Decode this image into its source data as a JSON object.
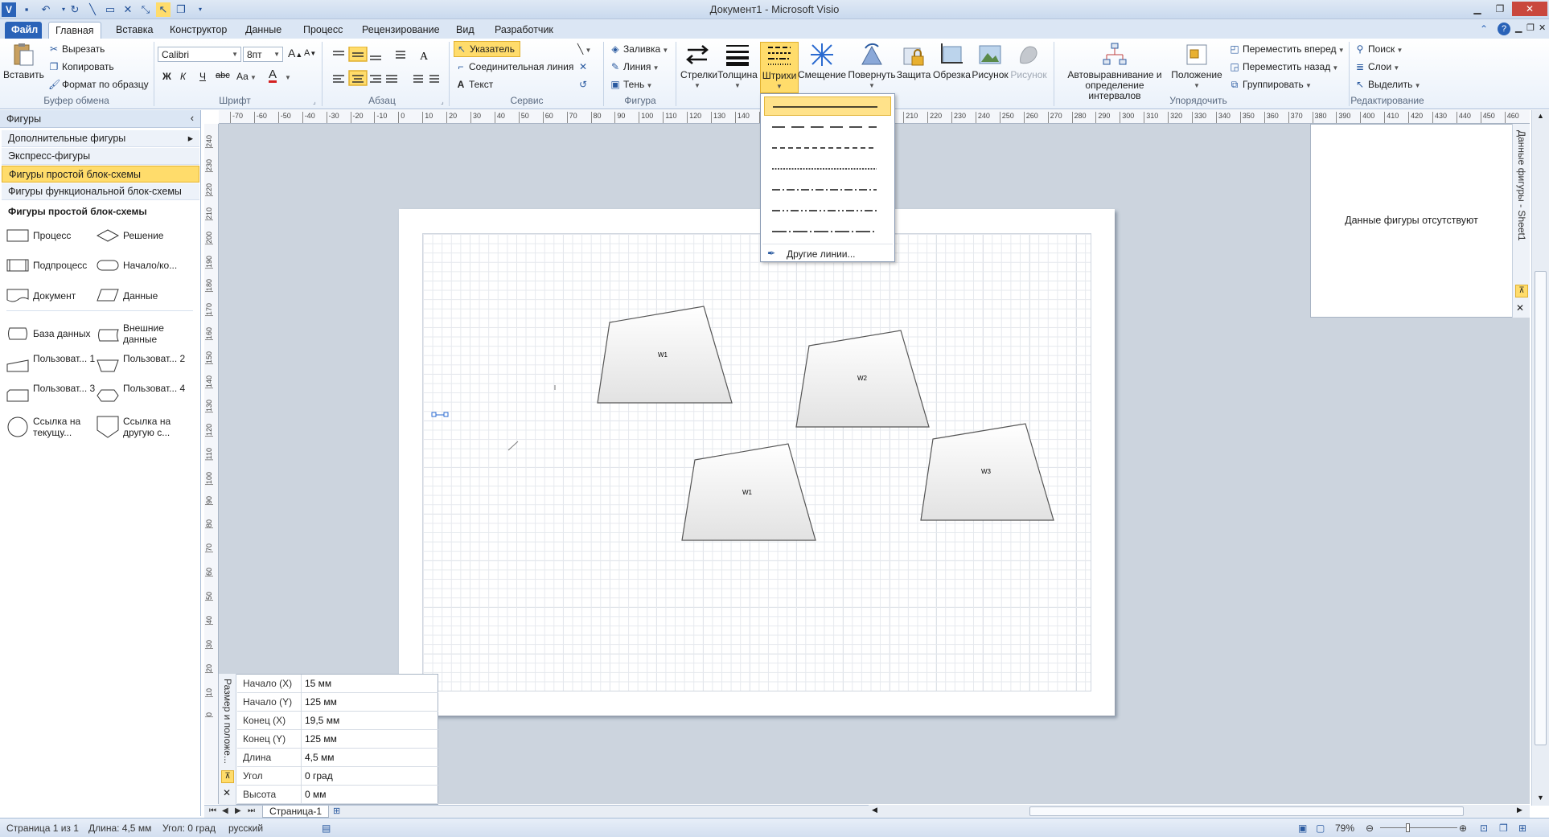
{
  "window": {
    "title": "Документ1  -  Microsoft Visio"
  },
  "tabs": [
    {
      "label": "Файл"
    },
    {
      "label": "Главная"
    },
    {
      "label": "Вставка"
    },
    {
      "label": "Конструктор"
    },
    {
      "label": "Данные"
    },
    {
      "label": "Процесс"
    },
    {
      "label": "Рецензирование"
    },
    {
      "label": "Вид"
    },
    {
      "label": "Разработчик"
    }
  ],
  "ribbon": {
    "clipboard": {
      "paste": "Вставить",
      "cut": "Вырезать",
      "copy": "Копировать",
      "format_painter": "Формат по образцу",
      "label": "Буфер обмена"
    },
    "font": {
      "name": "Calibri",
      "size": "8пт",
      "bold": "Ж",
      "italic": "К",
      "underline": "Ч",
      "strike": "abc",
      "case": "Аа",
      "color": "A",
      "grow": "A",
      "label": "Шрифт"
    },
    "paragraph": {
      "label": "Абзац"
    },
    "tools": {
      "pointer": "Указатель",
      "connector": "Соединительная линия",
      "text": "Текст",
      "label": "Сервис"
    },
    "shape": {
      "fill": "Заливка",
      "line": "Линия",
      "shadow": "Тень",
      "label": "Фигура"
    },
    "big_buttons": [
      {
        "label": "Стрелки"
      },
      {
        "label": "Толщина"
      },
      {
        "label": "Штрихи"
      },
      {
        "label": "Смещение"
      },
      {
        "label": "Повернуть"
      },
      {
        "label": "Защита"
      },
      {
        "label": "Обрезка"
      },
      {
        "label": "Рисунок"
      },
      {
        "label": "Рисунок"
      }
    ],
    "arrange": {
      "auto_align_line1": "Автовыравнивание и",
      "auto_align_line2": "определение интервалов",
      "position": "Положение",
      "bring_forward": "Переместить вперед",
      "send_backward": "Переместить назад",
      "group": "Группировать",
      "label": "Упорядочить"
    },
    "editing": {
      "find": "Поиск",
      "layers": "Слои",
      "select": "Выделить",
      "label": "Редактирование"
    }
  },
  "shapes_pane": {
    "header": "Фигуры",
    "rows": [
      {
        "label": "Дополнительные фигуры"
      },
      {
        "label": "Экспресс-фигуры"
      },
      {
        "label": "Фигуры простой блок-схемы"
      },
      {
        "label": "Фигуры функциональной блок-схемы"
      }
    ],
    "stencil_title": "Фигуры простой блок-схемы",
    "stencil": [
      {
        "label": "Процесс"
      },
      {
        "label": "Решение"
      },
      {
        "label": "Подпроцесс"
      },
      {
        "label": "Начало/ко..."
      },
      {
        "label": "Документ"
      },
      {
        "label": "Данные"
      },
      {
        "label": "База данных"
      },
      {
        "label": "Внешние данные"
      },
      {
        "label": "Пользоват... 1"
      },
      {
        "label": "Пользоват... 2"
      },
      {
        "label": "Пользоват... 3"
      },
      {
        "label": "Пользоват... 4"
      },
      {
        "label": "Ссылка на текущу..."
      },
      {
        "label": "Ссылка на другую с..."
      }
    ]
  },
  "dash_menu": {
    "more_lines": "Другие линии..."
  },
  "ruler": {
    "h_ticks": [
      "-70",
      "-60",
      "-50",
      "-40",
      "-30",
      "-20",
      "-10",
      "0",
      "10",
      "20",
      "30",
      "40",
      "50",
      "60",
      "70",
      "80",
      "90",
      "100",
      "110",
      "120",
      "130",
      "140",
      "150",
      "160",
      "170",
      "180",
      "190",
      "200",
      "210",
      "220",
      "230",
      "240",
      "250",
      "260",
      "270",
      "280",
      "290",
      "300",
      "310",
      "320",
      "330",
      "340",
      "350",
      "360",
      "370",
      "380",
      "390",
      "400",
      "410",
      "420",
      "430",
      "440",
      "450",
      "460"
    ],
    "v_ticks": [
      "240",
      "230",
      "220",
      "210",
      "200",
      "190",
      "180",
      "170",
      "160",
      "150",
      "140",
      "130",
      "120",
      "110",
      "100",
      "90",
      "80",
      "70",
      "60",
      "50",
      "40",
      "30",
      "20",
      "10",
      "0"
    ]
  },
  "diagram_shapes": [
    {
      "label": "W1"
    },
    {
      "label": "W2"
    },
    {
      "label": "W1"
    },
    {
      "label": "W3"
    }
  ],
  "shape_data_pane": {
    "title": "Данные фигуры - Sheet1",
    "message": "Данные фигуры отсутствуют"
  },
  "size_pane": {
    "title": "Размер и положе...",
    "rows": [
      {
        "key": "Начало (X)",
        "value": "15 мм"
      },
      {
        "key": "Начало (Y)",
        "value": "125 мм"
      },
      {
        "key": "Конец (X)",
        "value": "19,5 мм"
      },
      {
        "key": "Конец (Y)",
        "value": "125 мм"
      },
      {
        "key": "Длина",
        "value": "4,5 мм"
      },
      {
        "key": "Угол",
        "value": "0 град"
      },
      {
        "key": "Высота",
        "value": "0 мм"
      }
    ]
  },
  "page_tab": "Страница-1",
  "status": {
    "page": "Страница 1 из 1",
    "length": "Длина: 4,5 мм",
    "angle": "Угол: 0 град",
    "language": "русский",
    "zoom": "79%"
  },
  "colors": {
    "accent": "#2a63b8",
    "selected": "#ffdc6b"
  }
}
